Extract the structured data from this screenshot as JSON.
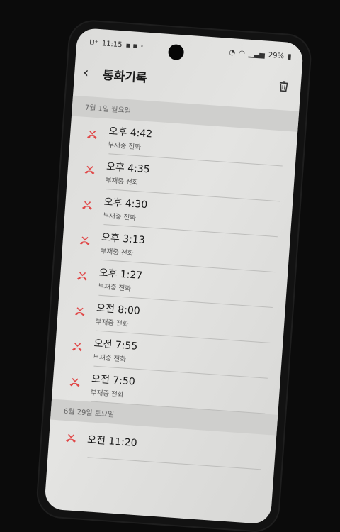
{
  "status_bar": {
    "carrier": "U⁺",
    "time": "11:15",
    "battery": "29%"
  },
  "header": {
    "title": "통화기록"
  },
  "icons": {
    "back": "back-arrow-icon",
    "delete": "trash-icon",
    "missed": "missed-call-icon"
  },
  "colors": {
    "missed_call": "#e04848"
  },
  "groups": [
    {
      "date": "7월 1일 월요일",
      "calls": [
        {
          "time": "오후 4:42",
          "type": "부재중 전화"
        },
        {
          "time": "오후 4:35",
          "type": "부재중 전화"
        },
        {
          "time": "오후 4:30",
          "type": "부재중 전화"
        },
        {
          "time": "오후 3:13",
          "type": "부재중 전화"
        },
        {
          "time": "오후 1:27",
          "type": "부재중 전화"
        },
        {
          "time": "오전 8:00",
          "type": "부재중 전화"
        },
        {
          "time": "오전 7:55",
          "type": "부재중 전화"
        },
        {
          "time": "오전 7:50",
          "type": "부재중 전화"
        }
      ]
    },
    {
      "date": "6월 29일 토요일",
      "calls": [
        {
          "time": "오전 11:20",
          "type": ""
        }
      ]
    }
  ]
}
